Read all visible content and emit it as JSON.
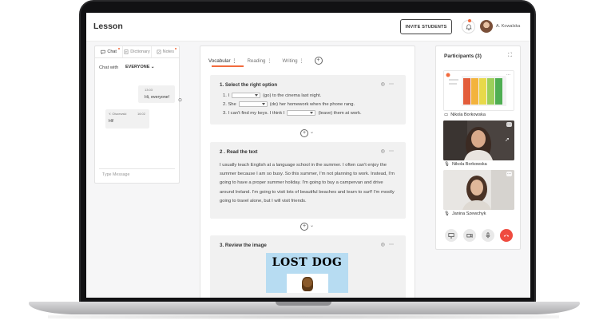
{
  "header": {
    "title": "Lesson",
    "invite_label": "INVITE STUDENTS",
    "user_name": "A. Kowalska"
  },
  "chat": {
    "tabs": [
      {
        "label": "Chat",
        "icon": "chat-icon"
      },
      {
        "label": "Dictionary",
        "icon": "dictionary-icon"
      },
      {
        "label": "Notes",
        "icon": "notes-icon"
      }
    ],
    "chat_with_label": "Chat with",
    "chat_with_value": "EVERYONE",
    "messages": [
      {
        "time": "13:03",
        "text": "Hi, everyone!"
      },
      {
        "sender": "Y. Olszewski",
        "time": "16:02",
        "text": "Hi!"
      }
    ],
    "input_placeholder": "Type Message"
  },
  "lesson": {
    "tabs": [
      {
        "label": "Vocabular",
        "active": true
      },
      {
        "label": "Reading",
        "active": false
      },
      {
        "label": "Writing",
        "active": false
      }
    ],
    "exercises": [
      {
        "title": "1. Select the right option",
        "lines": [
          {
            "num": "1. I",
            "after": "(go) to the cinema last night."
          },
          {
            "num": "2. She",
            "after": "(do) her homework when the phone rang."
          },
          {
            "num": "3. I can't find my keys. I think I",
            "after": "(leave) them at work."
          }
        ]
      },
      {
        "title": "2 . Read the text",
        "text": "I usually teach English at a language school in the summer. I often can't enjoy the summer because I am so busy. So this summer, I'm not planning to work. Instead, I'm going to have a proper summer holiday. I'm going to buy a campervan and drive around Ireland. I'm going to visit lots of beautiful beaches and learn to surf! I'm mostly going to travel alone, but I will visit friends."
      },
      {
        "title": "3. Review the image",
        "poster_text": "LOST DOG"
      }
    ]
  },
  "participants": {
    "title": "Participants (3)",
    "people": [
      {
        "name": "Nikola Borkowska",
        "icon": "screen-share-icon"
      },
      {
        "name": "Nikola Borkowska",
        "icon": "microphone-icon"
      },
      {
        "name": "Janina Szewchyk",
        "icon": "microphone-muted-icon"
      }
    ],
    "controls": [
      "screen-share-icon",
      "camera-icon",
      "microphone-icon",
      "end-call-icon"
    ]
  },
  "colors": {
    "accent": "#f26a3d",
    "end_call": "#ef4b3f",
    "poster_bg": "#b7dcf2"
  }
}
